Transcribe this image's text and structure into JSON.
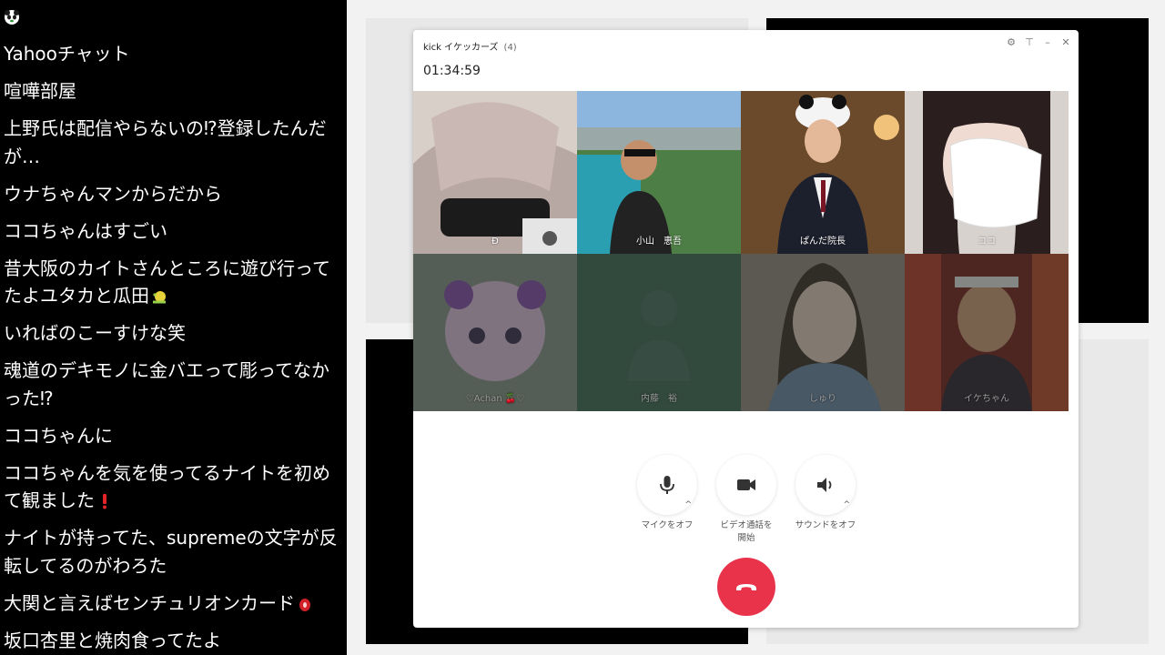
{
  "chat": {
    "top_icon": "panda-icon",
    "messages": [
      {
        "text": "Yahooチャット"
      },
      {
        "text": "喧嘩部屋"
      },
      {
        "text": "上野氏は配信やらないの⁉登録したんだが…"
      },
      {
        "text": "ウナちゃんマンからだから"
      },
      {
        "text": "ココちゃんはすごい"
      },
      {
        "text": "昔大阪のカイトさんところに遊び行ってたよユタカと瓜田",
        "emoji": "snail-emoji"
      },
      {
        "text": "いればのこーすけな笑"
      },
      {
        "text": "魂道のデキモノに金バエって彫ってなかった⁉"
      },
      {
        "text": "ココちゃんに"
      },
      {
        "text": "ココちゃんを気を使ってるナイトを初めて観ました",
        "emoji": "exclamation-emoji"
      },
      {
        "text": "ナイトが持ってた、supremeの文字が反転してるのがわろた"
      },
      {
        "text": "大関と言えばセンチュリオンカード",
        "emoji": "red-ornament-emoji"
      },
      {
        "text": "坂口杏里と焼肉食ってたよ"
      }
    ]
  },
  "call": {
    "title": "kick イケッカーズ",
    "count": "(4)",
    "timer": "01:34:59",
    "participants": [
      {
        "name": "Đ"
      },
      {
        "name": "小山　恵吾"
      },
      {
        "name": "ぱんだ院長"
      },
      {
        "name": "ココ"
      },
      {
        "name": "♡Achan 🍒♡"
      },
      {
        "name": "内藤　裕"
      },
      {
        "name": "しゅり"
      },
      {
        "name": "イケちゃん"
      }
    ],
    "controls": {
      "mic_label": "マイクをオフ",
      "video_label_1": "ビデオ通話を",
      "video_label_2": "開始",
      "sound_label": "サウンドをオフ"
    },
    "colors": {
      "hangup": "#e8334a"
    }
  }
}
